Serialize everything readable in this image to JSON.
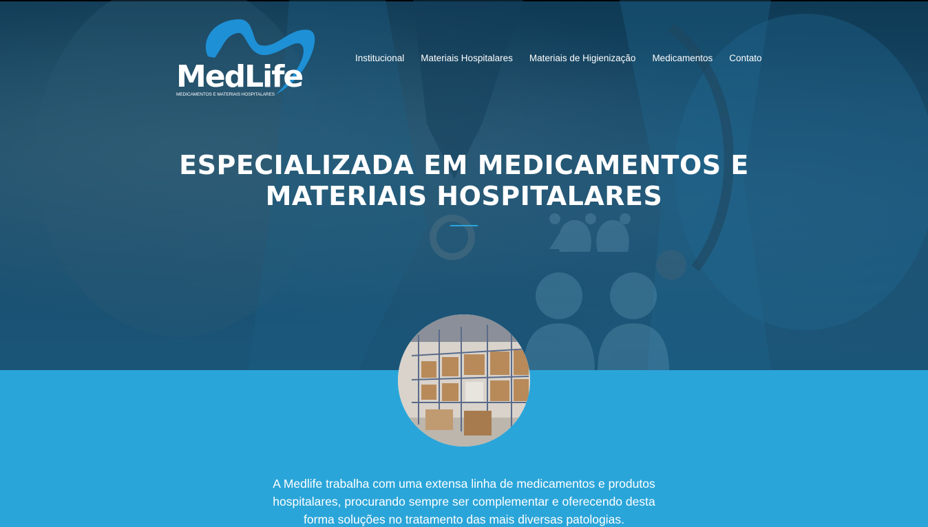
{
  "brand": {
    "name": "MedLife",
    "tagline": "MEDICAMENTOS E MATERIAIS HOSPITALARES",
    "accent_color": "#2aa5d9",
    "logo_swoosh_color": "#1e90d6"
  },
  "nav": {
    "items": [
      {
        "label": "Institucional"
      },
      {
        "label": "Materiais Hospitalares"
      },
      {
        "label": "Materiais de Higienização"
      },
      {
        "label": "Medicamentos"
      },
      {
        "label": "Contato"
      }
    ]
  },
  "hero": {
    "headline_line1": "ESPECIALIZADA EM MEDICAMENTOS E",
    "headline_line2": "MATERIAIS HOSPITALARES"
  },
  "intro": {
    "line1": "A Medlife trabalha com uma extensa linha de medicamentos e produtos",
    "line2": "hospitalares, procurando sempre ser complementar e oferecendo desta",
    "line3": "forma soluções no tratamento das mais diversas patologias."
  },
  "images": {
    "hero_background": "doctor-with-stethoscope-photo",
    "circle_photo": "warehouse-shelves-photo"
  }
}
